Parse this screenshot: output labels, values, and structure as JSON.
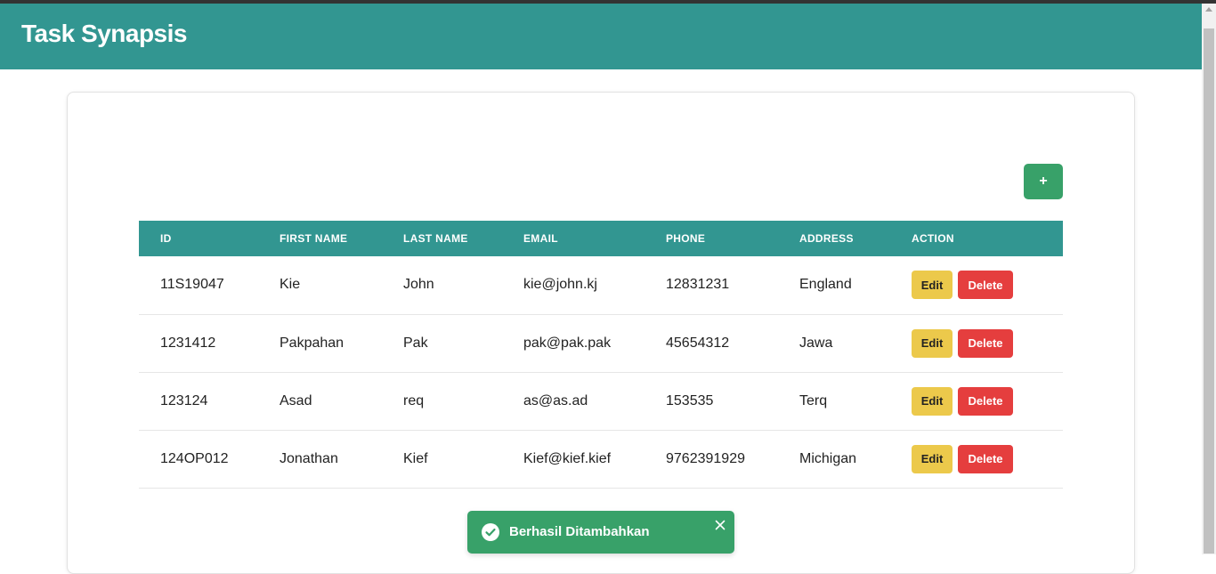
{
  "app": {
    "title": "Task Synapsis"
  },
  "toolbar": {
    "add_label": "+"
  },
  "table": {
    "headers": [
      "ID",
      "FIRST NAME",
      "LAST NAME",
      "EMAIL",
      "PHONE",
      "ADDRESS",
      "ACTION"
    ],
    "rows": [
      {
        "id": "11S19047",
        "first_name": "Kie",
        "last_name": "John",
        "email": "kie@john.kj",
        "phone": "12831231",
        "address": "England"
      },
      {
        "id": "1231412",
        "first_name": "Pakpahan",
        "last_name": "Pak",
        "email": "pak@pak.pak",
        "phone": "45654312",
        "address": "Jawa"
      },
      {
        "id": "123124",
        "first_name": "Asad",
        "last_name": "req",
        "email": "as@as.ad",
        "phone": "153535",
        "address": "Terq"
      },
      {
        "id": "124OP012",
        "first_name": "Jonathan",
        "last_name": "Kief",
        "email": "Kief@kief.kief",
        "phone": "9762391929",
        "address": "Michigan"
      }
    ],
    "edit_label": "Edit",
    "delete_label": "Delete"
  },
  "toast": {
    "message": "Berhasil Ditambahkan",
    "icon": "check-circle-icon",
    "close_icon": "close-icon"
  },
  "colors": {
    "primary": "#329691",
    "success": "#38a169",
    "warning": "#ecc94b",
    "danger": "#e53e3e"
  }
}
